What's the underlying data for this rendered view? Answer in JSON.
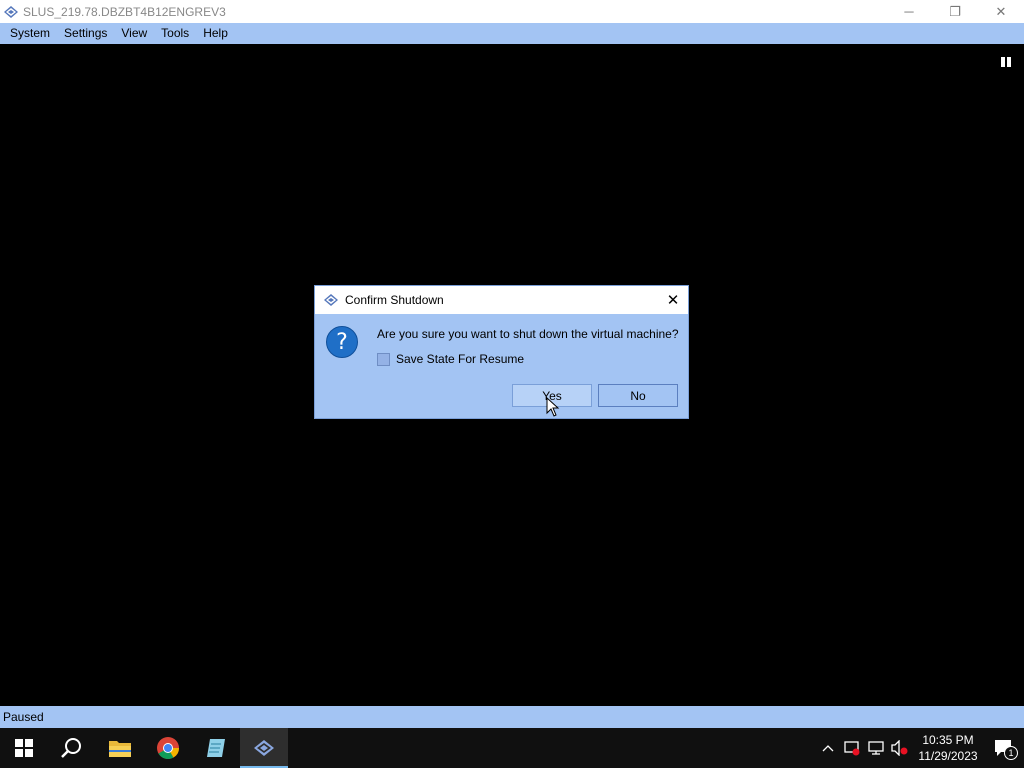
{
  "window": {
    "title": "SLUS_219.78.DBZBT4B12ENGREV3",
    "controls": {
      "minimize": "─",
      "restore": "❐",
      "close": "✕"
    }
  },
  "menubar": {
    "items": [
      {
        "label": "System"
      },
      {
        "label": "Settings"
      },
      {
        "label": "View"
      },
      {
        "label": "Tools"
      },
      {
        "label": "Help"
      }
    ]
  },
  "status": {
    "text": "Paused"
  },
  "dialog": {
    "title": "Confirm Shutdown",
    "close": "✕",
    "icon": "question-icon",
    "icon_glyph": "?",
    "message": "Are you sure you want to shut down the virtual machine?",
    "checkbox_label": "Save State For Resume",
    "checkbox_checked": false,
    "yes_label": "Yes",
    "no_label": "No"
  },
  "taskbar": {
    "apps": [
      "windows-start",
      "search",
      "file-explorer",
      "chrome",
      "notepad",
      "pcsx2"
    ],
    "tray": {
      "chevron": "^",
      "time": "10:35 PM",
      "date": "11/29/2023",
      "notification_count": "1"
    }
  },
  "colors": {
    "menubar": "#a3c4f3",
    "dialog_body": "#a3c4f3",
    "taskbar": "#101010",
    "display": "#000000"
  }
}
